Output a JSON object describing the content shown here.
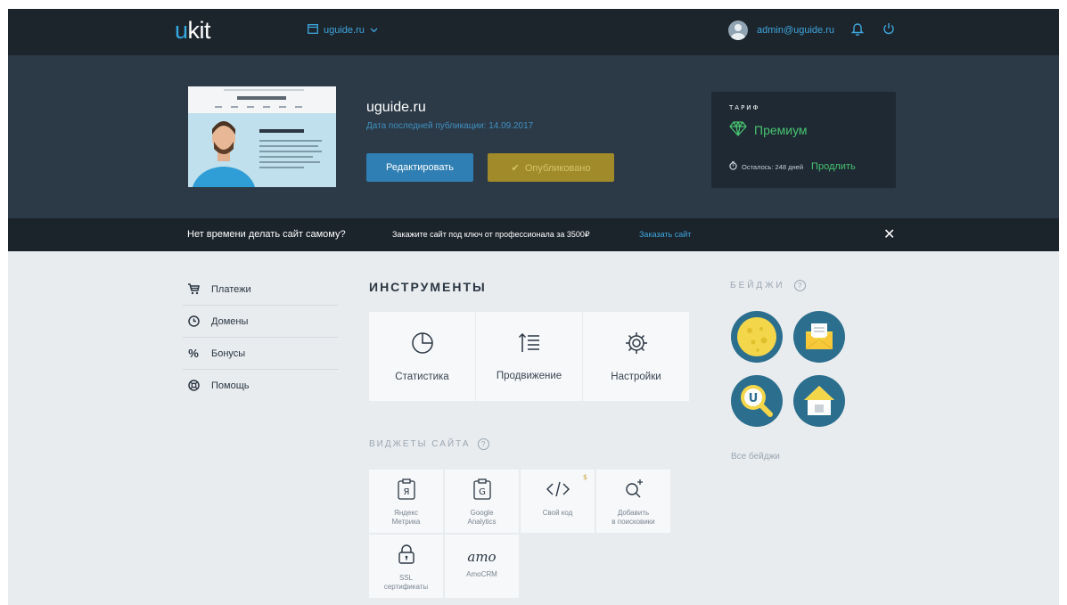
{
  "topnav": {
    "logo_u": "u",
    "logo_rest": "kit",
    "site": "uguide.ru",
    "user_email": "admin@uguide.ru"
  },
  "hero": {
    "site_title": "uguide.ru",
    "last_publish": "Дата последней публикации: 14.09.2017",
    "edit_label": "Редактировать",
    "published_label": "Опубликовано",
    "plan": {
      "label": "ТАРИФ",
      "name": "Премиум",
      "remaining": "Осталось: 248 дней",
      "renew": "Продлить"
    }
  },
  "promo": {
    "question": "Нет времени делать сайт самому?",
    "text": "Закажите сайт под ключ от профессионала за 3500₽",
    "link": "Заказать сайт"
  },
  "sidebar": {
    "items": [
      {
        "label": "Платежи",
        "icon": "cart-icon"
      },
      {
        "label": "Домены",
        "icon": "globe-icon"
      },
      {
        "label": "Бонусы",
        "icon": "percent-icon"
      },
      {
        "label": "Помощь",
        "icon": "lifebuoy-icon"
      }
    ]
  },
  "tools": {
    "title": "ИНСТРУМЕНТЫ",
    "items": [
      {
        "label": "Статистика",
        "icon": "pie-chart-icon"
      },
      {
        "label": "Продвижение",
        "icon": "sort-icon"
      },
      {
        "label": "Настройки",
        "icon": "gear-icon"
      }
    ]
  },
  "widgets": {
    "title": "ВИДЖЕТЫ САЙТА",
    "items": [
      {
        "label": "Яндекс\nМетрика",
        "icon": "yandex-metrica-icon"
      },
      {
        "label": "Google\nAnalytics",
        "icon": "google-analytics-icon"
      },
      {
        "label": "Свой код",
        "icon": "code-icon",
        "badge": "$"
      },
      {
        "label": "Добавить\nв поисковики",
        "icon": "search-plus-icon"
      },
      {
        "label": "SSL\nсертификаты",
        "icon": "lock-icon"
      },
      {
        "label": "AmoCRM",
        "icon": "amo-logo",
        "logo_text": "amo"
      }
    ]
  },
  "badges": {
    "title": "БЕЙДЖИ",
    "all_label": "Все бейджи",
    "items": [
      "moon-badge-icon",
      "envelope-badge-icon",
      "search-u-badge-icon",
      "house-badge-icon"
    ]
  },
  "colors": {
    "accent": "#2f7fb4",
    "green": "#47c36e",
    "nav_bg": "#1c242c",
    "hero_bg": "#2c3a47"
  }
}
